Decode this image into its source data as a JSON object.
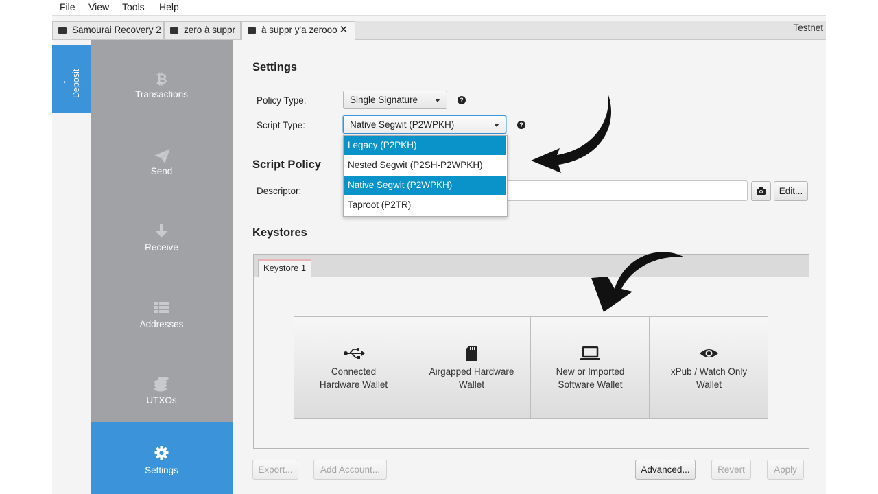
{
  "menu": [
    "File",
    "View",
    "Tools",
    "Help"
  ],
  "tabs": [
    {
      "label": "Samourai Recovery 2"
    },
    {
      "label": "zero à suppr"
    },
    {
      "label": "à suppr y'a zerooo",
      "close": "✕"
    }
  ],
  "network": "Testnet",
  "deposit": {
    "label": "Deposit"
  },
  "nav": [
    {
      "label": "Transactions",
      "icon": "bitcoin-icon"
    },
    {
      "label": "Send",
      "icon": "paper-plane-icon"
    },
    {
      "label": "Receive",
      "icon": "arrow-down-icon"
    },
    {
      "label": "Addresses",
      "icon": "list-icon"
    },
    {
      "label": "UTXOs",
      "icon": "coins-icon"
    },
    {
      "label": "Settings",
      "icon": "gear-icon",
      "active": true
    }
  ],
  "settings": {
    "title": "Settings",
    "policy_type": {
      "label": "Policy Type:",
      "value": "Single Signature"
    },
    "script_type": {
      "label": "Script Type:",
      "value": "Native Segwit (P2WPKH)",
      "options": [
        "Legacy (P2PKH)",
        "Nested Segwit (P2SH-P2WPKH)",
        "Native Segwit (P2WPKH)",
        "Taproot (P2TR)"
      ]
    }
  },
  "script_policy": {
    "title": "Script Policy",
    "descriptor_label": "Descriptor:",
    "edit_button": "Edit...",
    "camera_icon": "camera-icon"
  },
  "keystores": {
    "title": "Keystores",
    "tab": "Keystore 1",
    "import_options": [
      {
        "line1": "Connected",
        "line2": "Hardware Wallet",
        "icon": "usb-icon"
      },
      {
        "line1": "Airgapped Hardware",
        "line2": "Wallet",
        "icon": "sd-card-icon"
      },
      {
        "line1": "New or Imported",
        "line2": "Software Wallet",
        "icon": "laptop-icon"
      },
      {
        "line1": "xPub / Watch Only",
        "line2": "Wallet",
        "icon": "eye-icon"
      }
    ]
  },
  "footer": {
    "export": "Export...",
    "add_account": "Add Account...",
    "advanced": "Advanced...",
    "revert": "Revert",
    "apply": "Apply"
  },
  "colors": {
    "accent": "#3b94d9",
    "sidebar": "#a0a2a5",
    "highlight": "#0a93c9"
  }
}
